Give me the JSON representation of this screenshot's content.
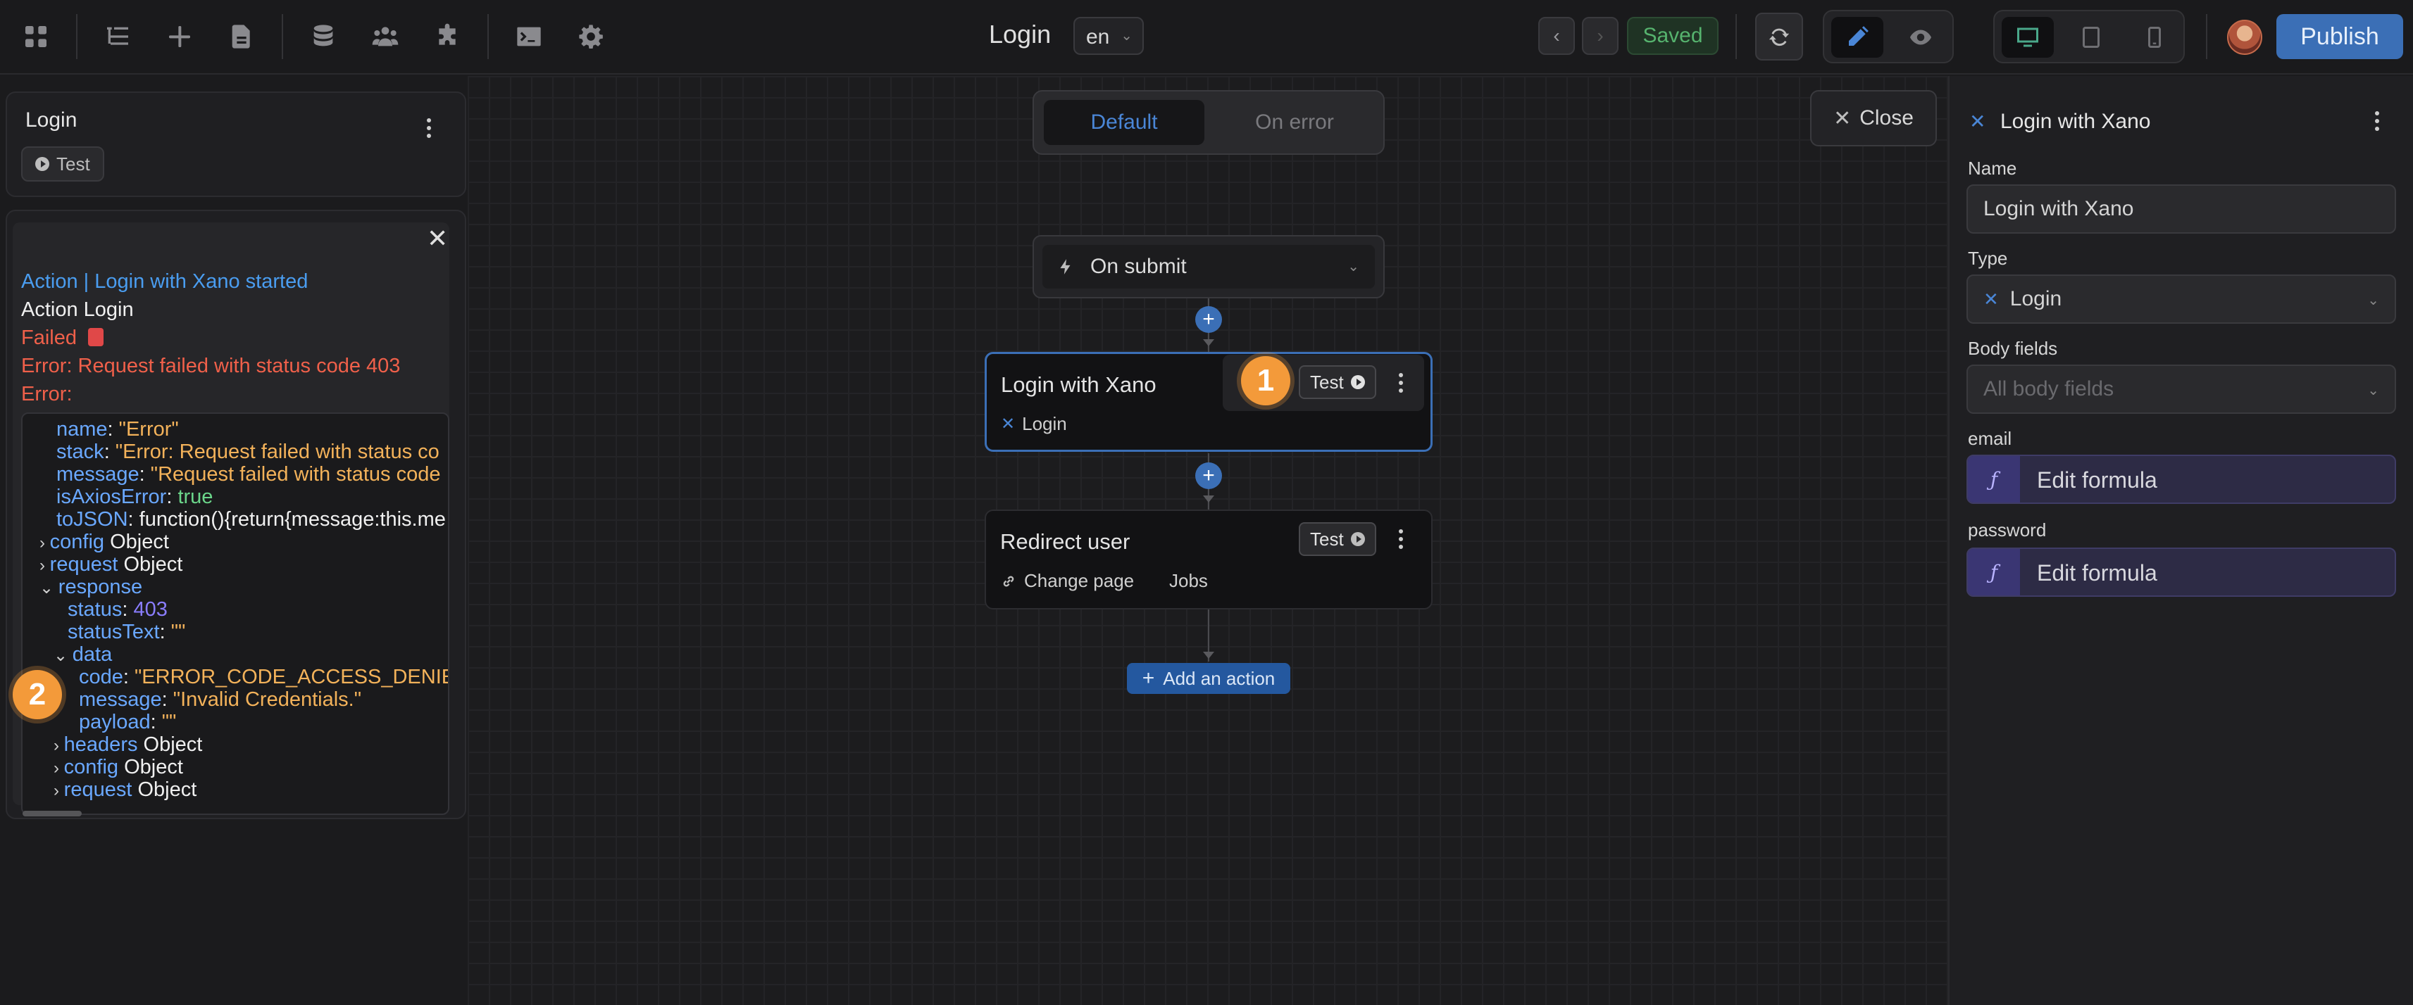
{
  "topbar": {
    "page_title": "Login",
    "language": "en",
    "saved_label": "Saved",
    "publish_label": "Publish"
  },
  "left_panel": {
    "workflow_title": "Login",
    "test_label": "Test"
  },
  "log": {
    "line1": "Action | Login with Xano started",
    "line2": "Action Login",
    "line3": "Failed",
    "line4": "Error: Request failed with status code 403",
    "line5": "Error:",
    "object_lines": [
      {
        "key": "name",
        "sep": ": ",
        "value": "\"Error\"",
        "type": "str"
      },
      {
        "key": "stack",
        "sep": ": ",
        "value": "\"Error: Request failed with status co",
        "type": "str"
      },
      {
        "key": "message",
        "sep": ": ",
        "value": "\"Request failed with status code",
        "type": "str"
      },
      {
        "key": "isAxiosError",
        "sep": ": ",
        "value": "true",
        "type": "bool"
      },
      {
        "key": "toJSON",
        "sep": ": ",
        "value": "function(){return{message:this.me",
        "type": "plain"
      },
      {
        "key": "config",
        "sep": " ",
        "value": "Object",
        "type": "plain",
        "arrow": "›"
      },
      {
        "key": "request",
        "sep": " ",
        "value": "Object",
        "type": "plain",
        "arrow": "›"
      },
      {
        "key": "response",
        "sep": "",
        "value": "",
        "type": "plain",
        "arrow": "⌄"
      },
      {
        "key": "status",
        "sep": ": ",
        "value": "403",
        "type": "num"
      },
      {
        "key": "statusText",
        "sep": ": ",
        "value": "\"\"",
        "type": "str"
      },
      {
        "key": "data",
        "sep": "",
        "value": "",
        "type": "plain",
        "arrow": "⌄"
      },
      {
        "key": "code",
        "sep": ": ",
        "value": "\"ERROR_CODE_ACCESS_DENIED\"",
        "type": "str"
      },
      {
        "key": "message",
        "sep": ": ",
        "value": "\"Invalid Credentials.\"",
        "type": "str"
      },
      {
        "key": "payload",
        "sep": ": ",
        "value": "\"\"",
        "type": "str"
      },
      {
        "key": "headers",
        "sep": " ",
        "value": "Object",
        "type": "plain",
        "arrow": "›"
      },
      {
        "key": "config",
        "sep": " ",
        "value": "Object",
        "type": "plain",
        "arrow": "›"
      },
      {
        "key": "request",
        "sep": " ",
        "value": "Object",
        "type": "plain",
        "arrow": "›"
      }
    ]
  },
  "annotations": {
    "badge1": "1",
    "badge2": "2"
  },
  "canvas": {
    "mode_default": "Default",
    "mode_on_error": "On error",
    "close_label": "Close",
    "trigger_label": "On submit",
    "card1_title": "Login with Xano",
    "card1_sub": "Login",
    "card1_test": "Test",
    "card2_title": "Redirect user",
    "card2_sub1": "Change page",
    "card2_sub2": "Jobs",
    "card2_test": "Test",
    "add_action_label": "Add an action"
  },
  "right_panel": {
    "title": "Login with Xano",
    "name_label": "Name",
    "name_value": "Login with Xano",
    "type_label": "Type",
    "type_value": "Login",
    "body_fields_label": "Body fields",
    "body_fields_placeholder": "All body fields",
    "email_label": "email",
    "email_formula": "Edit formula",
    "password_label": "password",
    "password_formula": "Edit formula"
  },
  "colors": {
    "accent": "#3b6fb6",
    "error": "#f0604a",
    "saved": "#56b36e",
    "badge": "#f39a3a"
  },
  "icons": [
    "apps-icon",
    "tree-icon",
    "plus-icon",
    "page-icon",
    "database-icon",
    "users-icon",
    "puzzle-icon",
    "terminal-icon",
    "gear-icon",
    "refresh-icon",
    "pencil-icon",
    "eye-icon",
    "desktop-icon",
    "tablet-icon",
    "mobile-icon",
    "bolt-icon",
    "xano-icon",
    "link-icon",
    "close-icon"
  ]
}
